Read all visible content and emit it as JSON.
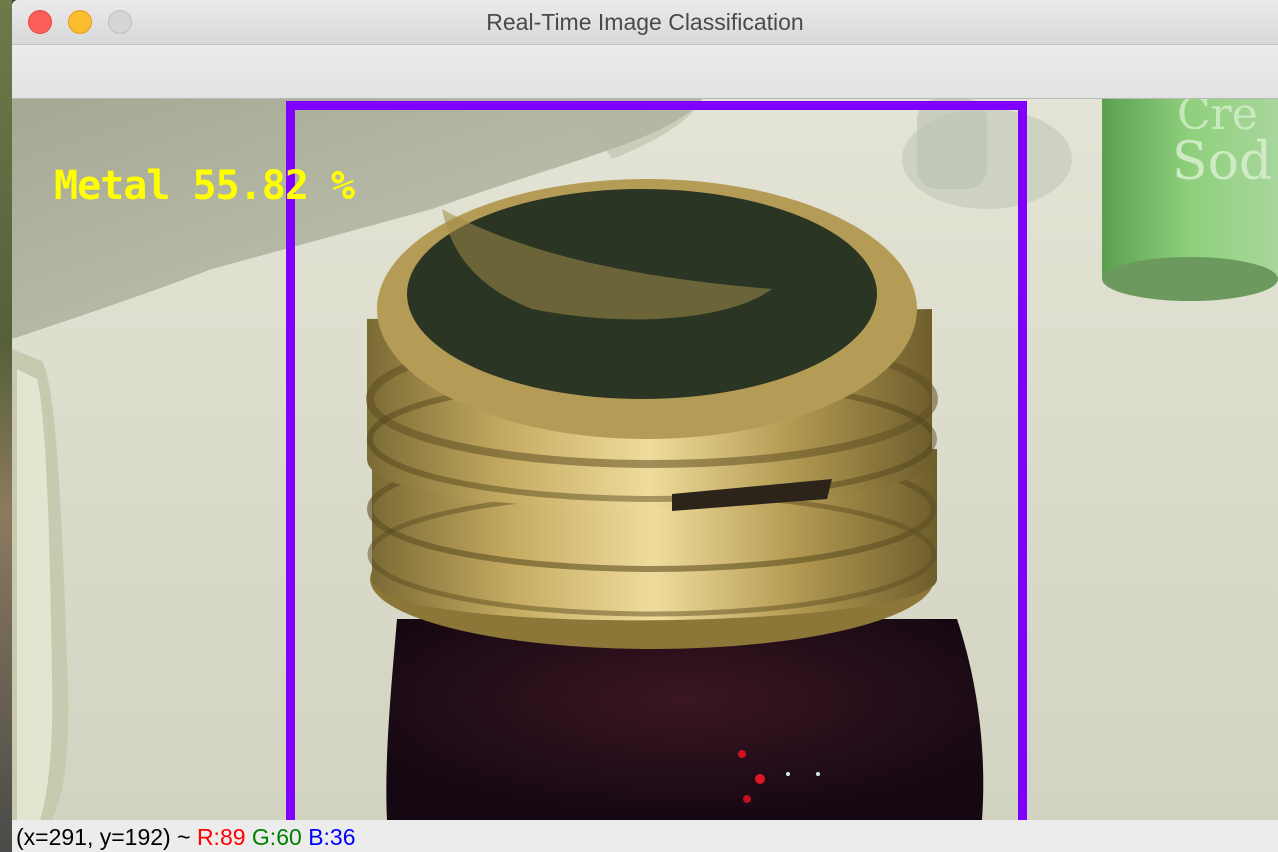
{
  "window": {
    "title": "Real-Time Image Classification"
  },
  "overlay": {
    "prediction_text": "Metal 55.82 %",
    "label_color": "#ffff00",
    "box_color": "#7f00ff"
  },
  "status": {
    "coords": "(x=291, y=192) ~",
    "r": "R:89",
    "g": "G:60",
    "b": "B:36",
    "r_color": "#ff0000",
    "g_color": "#008000",
    "b_color": "#0000ff"
  }
}
